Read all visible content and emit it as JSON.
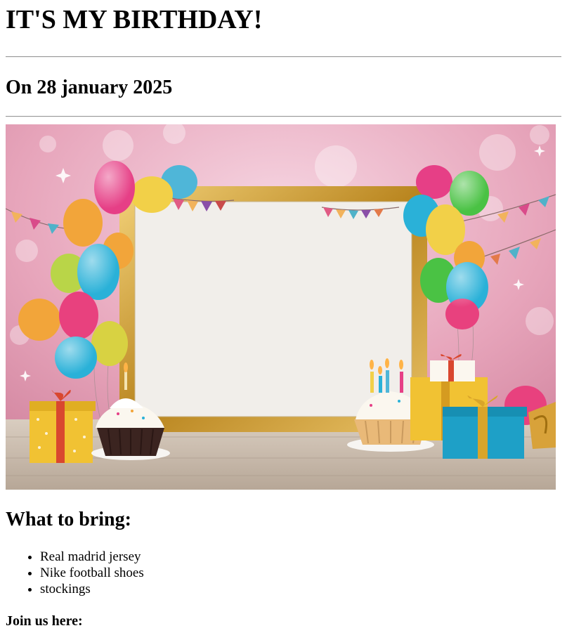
{
  "page": {
    "title": "IT'S MY BIRTHDAY!",
    "date_heading": "On 28 january 2025",
    "bring_heading": "What to bring:",
    "items": [
      "Real madrid jersey",
      "Nike football shoes",
      "stockings"
    ],
    "join_heading": "Join us here:"
  },
  "colors": {
    "background_pink": "#e8a7bd",
    "frame_gold": "#c99a2e",
    "card_white": "#f1eeea",
    "table_wood": "#cdbfb0"
  }
}
